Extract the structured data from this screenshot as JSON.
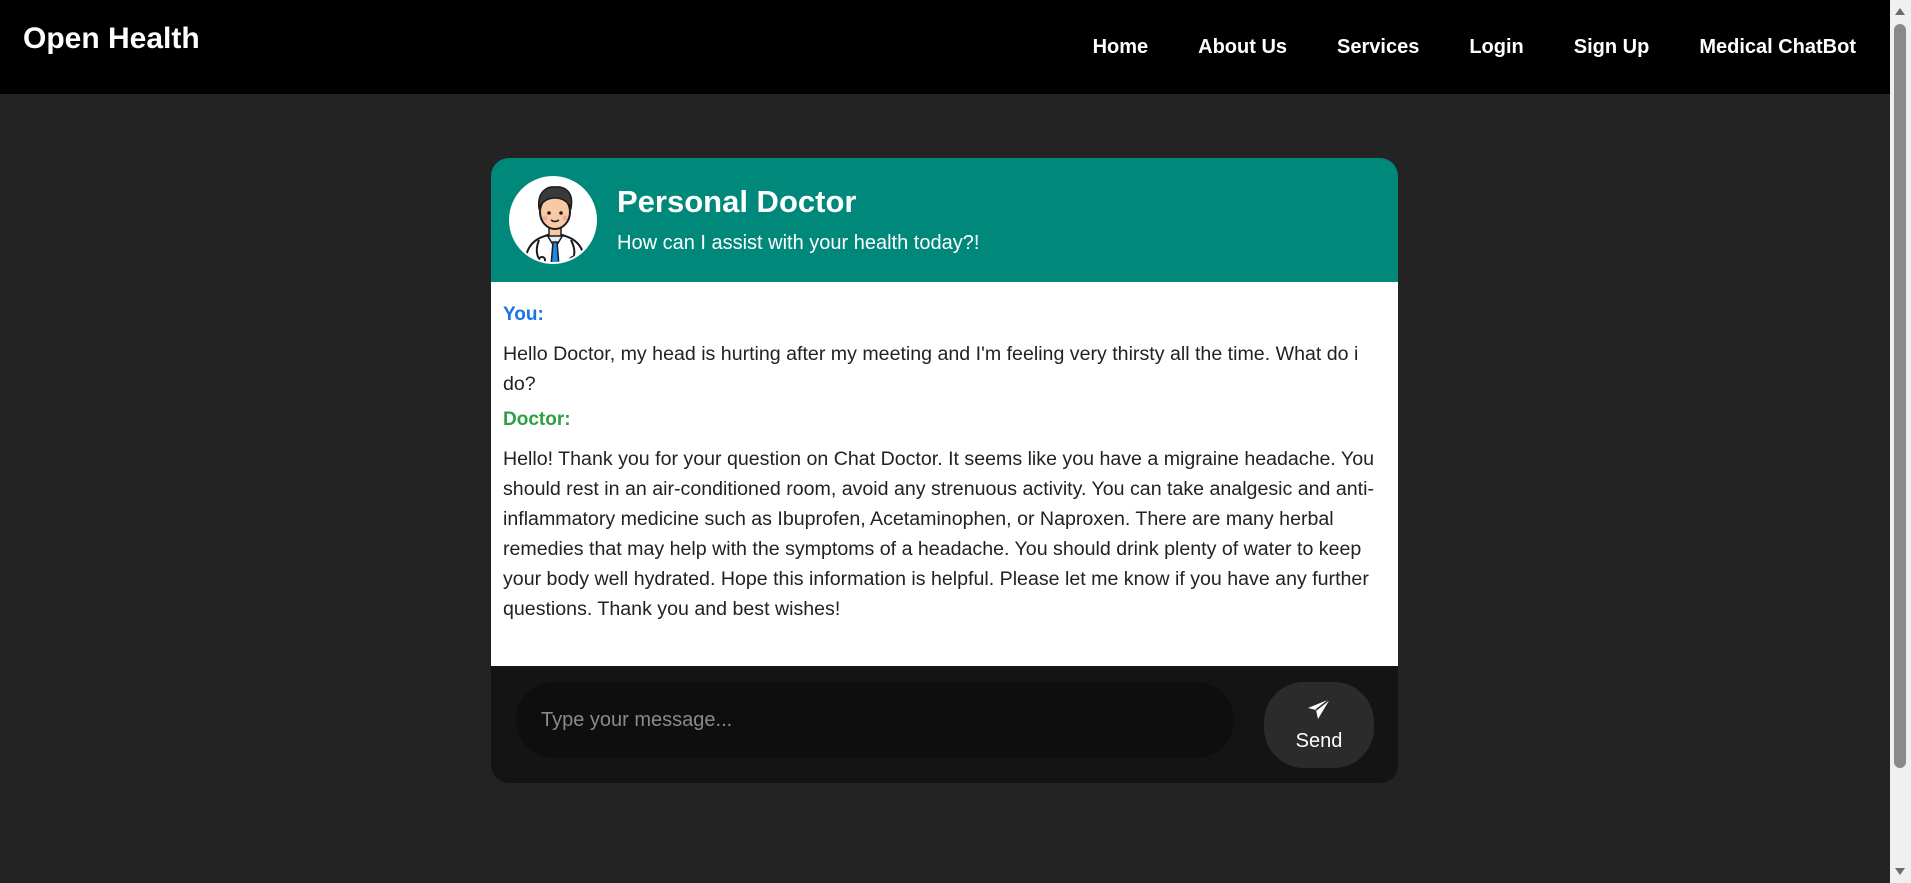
{
  "navbar": {
    "brand": "Open Health",
    "links": [
      "Home",
      "About Us",
      "Services",
      "Login",
      "Sign Up",
      "Medical ChatBot"
    ]
  },
  "chat": {
    "title": "Personal Doctor",
    "subtitle": "How can I assist with your health today?!",
    "avatar_icon": "doctor-icon",
    "messages": [
      {
        "sender": "You:",
        "text": "Hello Doctor, my head is hurting after my meeting and I'm feeling very thirsty all the time. What do i do?"
      },
      {
        "sender": "Doctor:",
        "text": "Hello! Thank you for your question on Chat Doctor. It seems like you have a migraine headache. You should rest in an air-conditioned room, avoid any strenuous activity. You can take analgesic and anti-inflammatory medicine such as Ibuprofen, Acetaminophen, or Naproxen. There are many herbal remedies that may help with the symptoms of a headache. You should drink plenty of water to keep your body well hydrated. Hope this information is helpful. Please let me know if you have any further questions. Thank you and best wishes!"
      }
    ],
    "input_placeholder": "Type your message...",
    "input_value": "",
    "send_label": "Send",
    "send_icon": "paper-plane-icon"
  },
  "colors": {
    "page_bg": "#232323",
    "navbar_bg": "#000000",
    "header_bg": "#00897b",
    "you_color": "#1a73e8",
    "doctor_color": "#2e9f45"
  }
}
